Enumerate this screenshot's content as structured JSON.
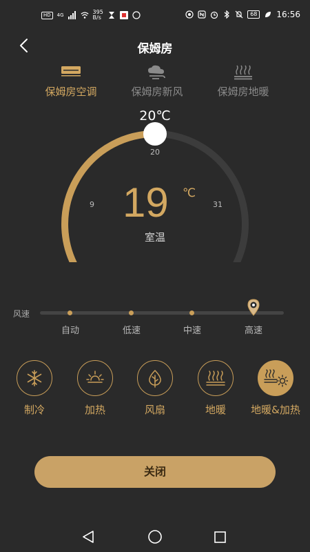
{
  "status_bar": {
    "hd": "HD",
    "signal_type": "4G",
    "net_speed_value": "395",
    "net_speed_unit": "B/s",
    "battery": "68",
    "time": "16:56"
  },
  "header": {
    "title": "保姆房"
  },
  "tabs": [
    {
      "label": "保姆房空调",
      "icon": "air-conditioner-icon",
      "active": true
    },
    {
      "label": "保姆房新风",
      "icon": "fresh-air-icon",
      "active": false
    },
    {
      "label": "保姆房地暖",
      "icon": "floor-heating-icon",
      "active": false
    }
  ],
  "thermostat": {
    "set_temp_label": "20℃",
    "set_temp": 20,
    "min": 9,
    "max": 31,
    "min_label": "9",
    "max_label": "31",
    "mid_label": "20",
    "room_temp": "19",
    "room_unit": "℃",
    "room_label": "室温"
  },
  "fan_speed": {
    "title": "风速",
    "options": [
      "自动",
      "低速",
      "中速",
      "高速"
    ],
    "selected": "高速"
  },
  "modes": [
    {
      "label": "制冷",
      "icon": "snowflake-icon",
      "active": false
    },
    {
      "label": "加热",
      "icon": "sun-icon",
      "active": false
    },
    {
      "label": "风扇",
      "icon": "leaf-icon",
      "active": false
    },
    {
      "label": "地暖",
      "icon": "floor-heat-icon",
      "active": false
    },
    {
      "label": "地暖&加热",
      "icon": "floor-heat-sun-icon",
      "active": true
    }
  ],
  "power": {
    "label": "关闭"
  },
  "colors": {
    "accent": "#c99e59",
    "background": "#2a2a2a",
    "track": "#3c3c3c"
  }
}
